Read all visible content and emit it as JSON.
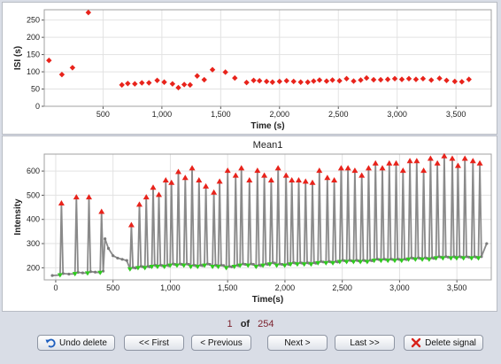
{
  "top_chart": {
    "title": "",
    "ylabel": "ISI (s)",
    "xlabel": "Time (s)",
    "xticks": [
      "500",
      "1,000",
      "1,500",
      "2,000",
      "2,500",
      "3,000",
      "3,500"
    ],
    "yticks": [
      "0",
      "50",
      "100",
      "150",
      "200",
      "250"
    ]
  },
  "bottom_chart": {
    "title": "Mean1",
    "ylabel": "Intensity",
    "xlabel": "Time(s)",
    "xticks": [
      "0",
      "500",
      "1,000",
      "1,500",
      "2,000",
      "2,500",
      "3,000",
      "3,500"
    ],
    "yticks": [
      "200",
      "300",
      "400",
      "500",
      "600"
    ]
  },
  "chart_data": [
    {
      "type": "scatter",
      "title": "",
      "xlabel": "Time (s)",
      "ylabel": "ISI (s)",
      "xlim": [
        0,
        3800
      ],
      "ylim": [
        0,
        280
      ],
      "grid": true,
      "marker": "diamond",
      "color": "#e8231b",
      "series": [
        {
          "x": [
            40,
            150,
            240,
            375,
            660,
            710,
            770,
            830,
            890,
            960,
            1020,
            1090,
            1140,
            1190,
            1240,
            1300,
            1360,
            1430,
            1540,
            1620,
            1720,
            1780,
            1830,
            1890,
            1940,
            2000,
            2060,
            2120,
            2180,
            2240,
            2290,
            2340,
            2400,
            2450,
            2510,
            2570,
            2630,
            2690,
            2740,
            2800,
            2860,
            2920,
            2980,
            3040,
            3100,
            3160,
            3220,
            3290,
            3360,
            3420,
            3490,
            3550,
            3610
          ],
          "y": [
            133,
            92,
            112,
            272,
            62,
            66,
            65,
            68,
            68,
            75,
            70,
            65,
            54,
            63,
            62,
            88,
            77,
            106,
            99,
            82,
            69,
            75,
            74,
            72,
            70,
            72,
            74,
            72,
            70,
            70,
            73,
            76,
            73,
            76,
            74,
            80,
            73,
            76,
            82,
            77,
            77,
            78,
            80,
            78,
            80,
            78,
            80,
            76,
            81,
            75,
            72,
            71,
            78
          ]
        }
      ]
    },
    {
      "type": "line",
      "title": "Mean1",
      "xlabel": "Time(s)",
      "ylabel": "Intensity",
      "xlim": [
        -100,
        3800
      ],
      "ylim": [
        150,
        670
      ],
      "grid": true,
      "series": [
        {
          "name": "",
          "color": "#8a8a8a",
          "peak_color": "#e8231b",
          "baseline_color": "#2ecc1e",
          "peak_times": [
            50,
            180,
            290,
            400,
            660,
            730,
            790,
            850,
            900,
            960,
            1010,
            1070,
            1130,
            1190,
            1250,
            1310,
            1380,
            1430,
            1500,
            1570,
            1620,
            1690,
            1760,
            1820,
            1880,
            1940,
            2010,
            2060,
            2120,
            2180,
            2240,
            2300,
            2370,
            2430,
            2490,
            2550,
            2610,
            2670,
            2730,
            2790,
            2850,
            2910,
            2970,
            3030,
            3090,
            3150,
            3210,
            3270,
            3330,
            3390,
            3460,
            3510,
            3570,
            3640,
            3700
          ],
          "peak_values": [
            465,
            490,
            490,
            430,
            375,
            460,
            490,
            530,
            500,
            560,
            550,
            595,
            570,
            610,
            560,
            535,
            510,
            555,
            600,
            580,
            610,
            560,
            600,
            580,
            560,
            610,
            580,
            560,
            560,
            555,
            550,
            600,
            570,
            560,
            610,
            610,
            600,
            580,
            610,
            630,
            610,
            630,
            630,
            600,
            640,
            640,
            600,
            650,
            630,
            660,
            650,
            620,
            650,
            640,
            630
          ],
          "baseline_values": [
            170,
            175,
            178,
            180,
            195,
            200,
            200,
            205,
            205,
            205,
            210,
            210,
            210,
            205,
            205,
            210,
            205,
            205,
            200,
            205,
            210,
            210,
            205,
            210,
            215,
            210,
            210,
            215,
            215,
            215,
            215,
            220,
            220,
            220,
            225,
            225,
            225,
            225,
            225,
            230,
            230,
            230,
            230,
            230,
            235,
            235,
            235,
            235,
            240,
            240,
            240,
            240,
            240,
            240,
            240
          ]
        }
      ]
    }
  ],
  "navigation": {
    "current_page": "1",
    "of_label": "of",
    "total_pages": "254"
  },
  "buttons": {
    "undo_delete": "Undo delete",
    "first": "<< First",
    "previous": "< Previous",
    "next": "Next >",
    "last": "Last >>",
    "delete_signal": "Delete signal"
  },
  "colors": {
    "peak": "#e8231b",
    "trough": "#2ecc1e",
    "trace": "#8a8a8a",
    "background": "#d9dde6"
  },
  "icons": {
    "undo": "undo-icon",
    "delete": "red-x-icon"
  }
}
